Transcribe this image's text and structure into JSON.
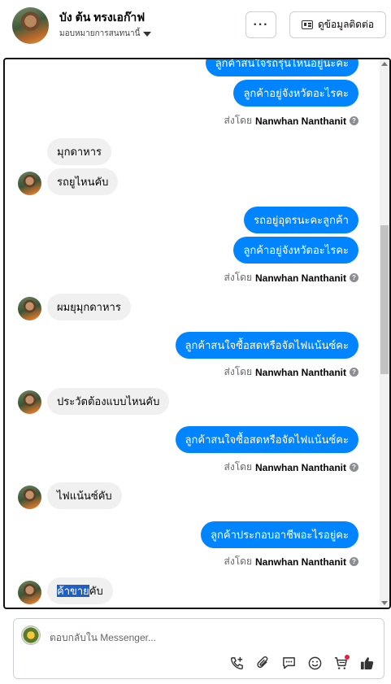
{
  "header": {
    "name": "บัง ต้น ทรงเอก๊าฟ",
    "subtitle": "มอบหมายการสนทนานี้",
    "more_label": "···",
    "contact_label": "ดูข้อมูลติดต่อ"
  },
  "messages": {
    "m1": "ลูกค้าสนใจรถรุ่นไหนอยู่นะคะ",
    "m2": "ลูกค้าอยู่จังหวัดอะไรคะ",
    "m3": "มุกดาหาร",
    "m4": "รถยูไหนคับ",
    "m5": "รถอยู่อุดรนะคะลูกค้า",
    "m6": "ลูกค้าอยู่จังหวัดอะไรคะ",
    "m7": "ผมยุมุกดาหาร",
    "m8": "ลูกค้าสนใจซื้อสดหรือจัดไฟแน้นซ์คะ",
    "m9": "ประวัตต้องแบบไหนคับ",
    "m10": "ลูกค้าสนใจซื้อสดหรือจัดไฟแน้นซ์คะ",
    "m11": "ไฟแน้นซ์คับ",
    "m12": "ลูกค้าประกอบอาชีพอะไรอยู่คะ",
    "m13_highlight": "ค้าขาย",
    "m13_rest": "คับ"
  },
  "sent_by": {
    "prefix": "ส่งโดย",
    "name": "Nanwhan Nanthanit",
    "help": "?"
  },
  "composer": {
    "placeholder": "ตอบกลับใน Messenger..."
  },
  "colors": {
    "outgoing": "#0084ff",
    "incoming": "#f0f0f0",
    "highlight": "#1f5fbf"
  }
}
